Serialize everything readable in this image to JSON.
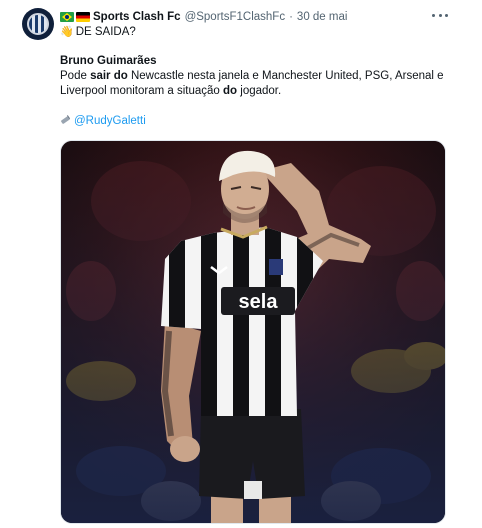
{
  "tweet": {
    "author_name": "Sports Clash Fc",
    "handle": "@SportsF1ClashFc",
    "separator": "·",
    "date": "30 de mai",
    "headline": "DE SAIDA?",
    "player_name": "Bruno Guimarães",
    "body_line1_a": "Pode ",
    "body_line1_b": "sair do",
    "body_line1_c": " Newcastle nesta janela e Manchester United, PSG, Arsenal e",
    "body_line2_a": "Liverpool monitoram a situação ",
    "body_line2_b": "do",
    "body_line2_c": " jogador.",
    "source_link": "@RudyGaletti",
    "shirt_sponsor": "sela"
  },
  "icons": {
    "avatar": "club-crest-icon",
    "flags": [
      "brazil-flag-icon",
      "germany-flag-icon"
    ],
    "headline_emoji": "waving-hand-icon",
    "source_emoji": "syringe-icon",
    "menu": "more-options-icon"
  },
  "colors": {
    "text": "#0f1419",
    "secondary": "#536471",
    "link": "#1d9bf0"
  }
}
